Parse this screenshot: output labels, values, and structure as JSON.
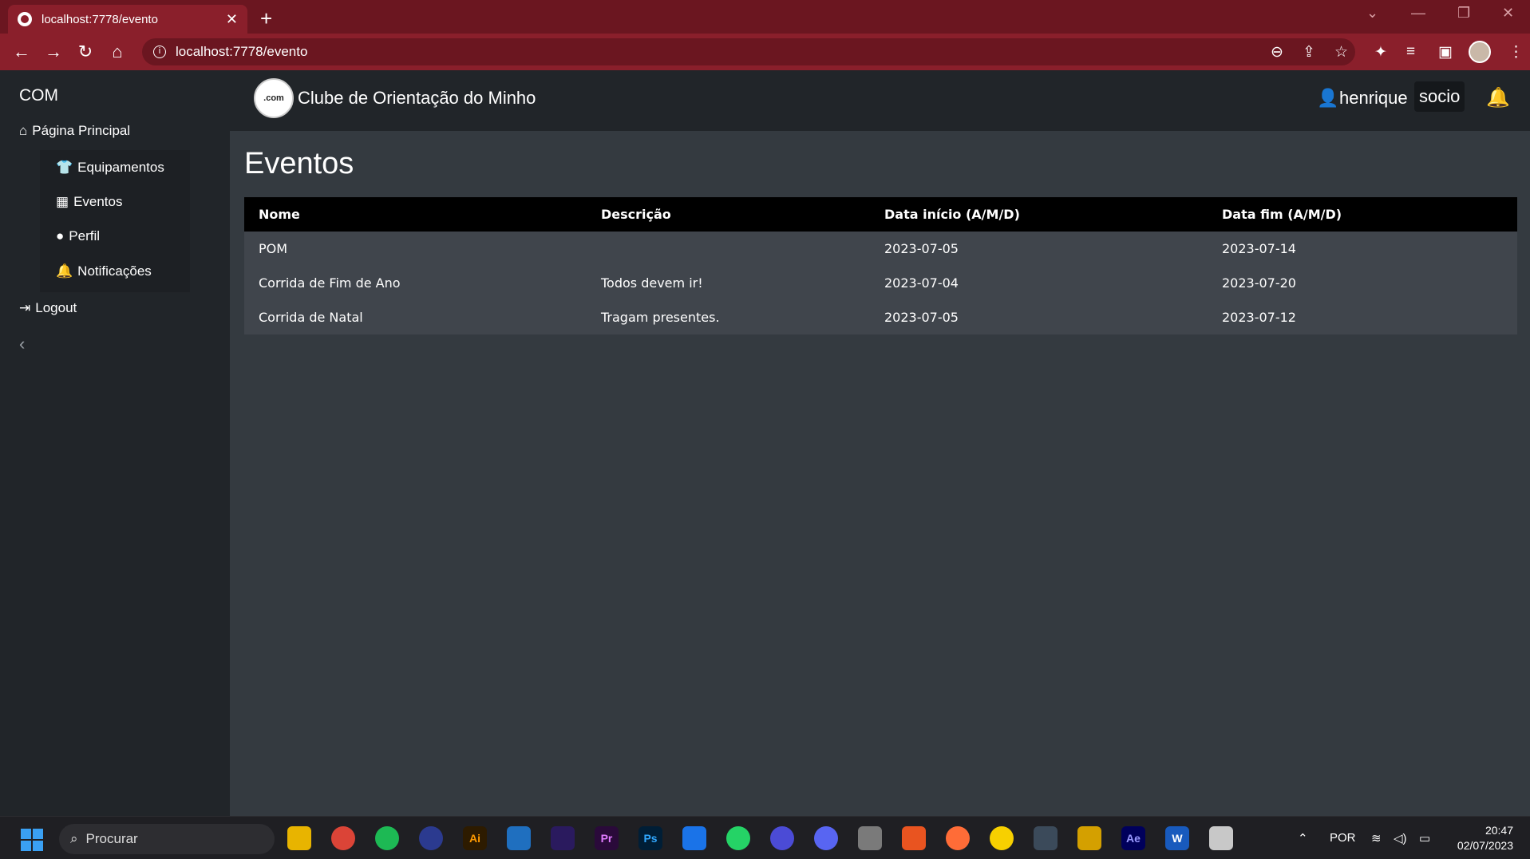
{
  "browser": {
    "tab_title": "localhost:7778/evento",
    "url": "localhost:7778/evento"
  },
  "sidebar": {
    "brand": "COM",
    "home": "Página Principal",
    "items": [
      {
        "label": "Equipamentos"
      },
      {
        "label": "Eventos"
      },
      {
        "label": "Perfil"
      },
      {
        "label": "Notificações"
      }
    ],
    "logout": "Logout"
  },
  "header": {
    "logo_text": ".com",
    "site_title": "Clube de Orientação do Minho",
    "user_name": "henrique",
    "role": "socio"
  },
  "main": {
    "title": "Eventos",
    "table": {
      "headers": [
        "Nome",
        "Descrição",
        "Data início (A/M/D)",
        "Data fim (A/M/D)"
      ],
      "rows": [
        [
          "POM",
          "",
          "2023-07-05",
          "2023-07-14"
        ],
        [
          "Corrida de Fim de Ano",
          "Todos devem ir!",
          "2023-07-04",
          "2023-07-20"
        ],
        [
          "Corrida de Natal",
          "Tragam presentes.",
          "2023-07-05",
          "2023-07-12"
        ]
      ]
    }
  },
  "taskbar": {
    "search_placeholder": "Procurar",
    "language": "POR",
    "time": "20:47",
    "date": "02/07/2023",
    "apps": [
      "Ai",
      "Pr",
      "Ps",
      "Ae",
      "W"
    ]
  },
  "colors": {
    "browser_frame": "#6b1620",
    "browser_toolbar": "#8a1f2b",
    "sidebar_bg": "#212529",
    "content_bg": "#343a40",
    "table_header_bg": "#000000",
    "table_row_bg": "#40454c"
  }
}
